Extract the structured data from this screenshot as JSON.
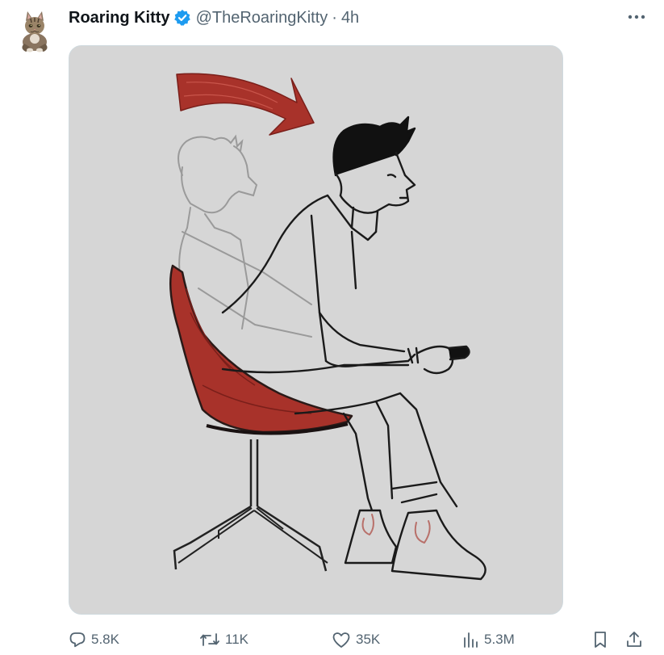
{
  "tweet": {
    "author_name": "Roaring Kitty",
    "handle": "@TheRoaringKitty",
    "separator": "·",
    "time": "4h",
    "verified": true,
    "avatar_icon": "cat-avatar-icon",
    "more_icon": "more-dots-icon"
  },
  "media": {
    "description_icon": "sketch-man-leaning-forward-in-red-chair-icon",
    "background_color": "#d6d6d6",
    "accent_color": "#a8322a"
  },
  "actions": {
    "replies": "5.8K",
    "retweets": "11K",
    "likes": "35K",
    "views": "5.3M"
  },
  "colors": {
    "text_primary": "#0f1419",
    "text_secondary": "#536471",
    "verified_blue": "#1d9bf0"
  }
}
